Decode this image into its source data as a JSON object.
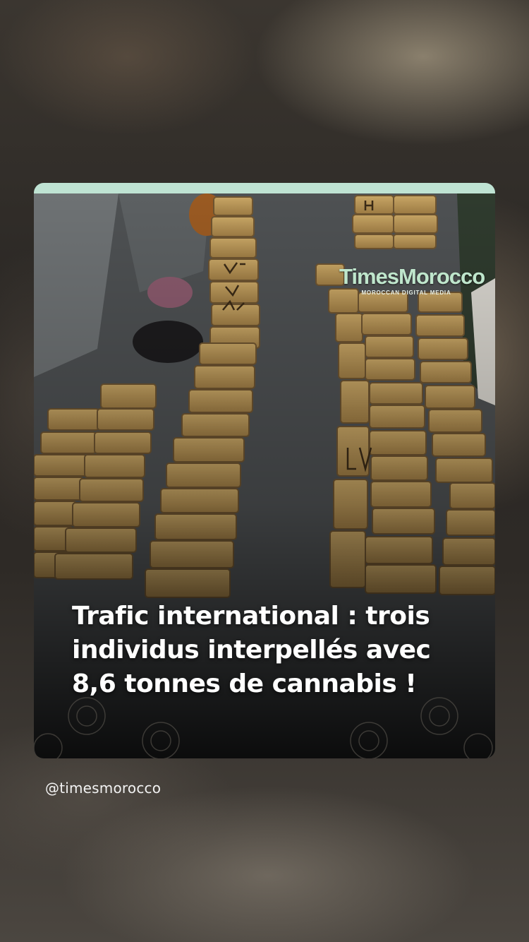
{
  "post": {
    "logo": {
      "name": "TimesMorocco",
      "tagline": "MOROCCAN DIGITAL MEDIA"
    },
    "headline": "Trafic international : trois individus interpellés avec 8,6 tonnes de cannabis !",
    "username": "@timesmorocco",
    "photo_label": "bales-of-cannabis-photo"
  },
  "colors": {
    "accent_bar": "#bfe3d3",
    "logo_green": "#bfe6cc",
    "headline_text": "#ffffff"
  }
}
